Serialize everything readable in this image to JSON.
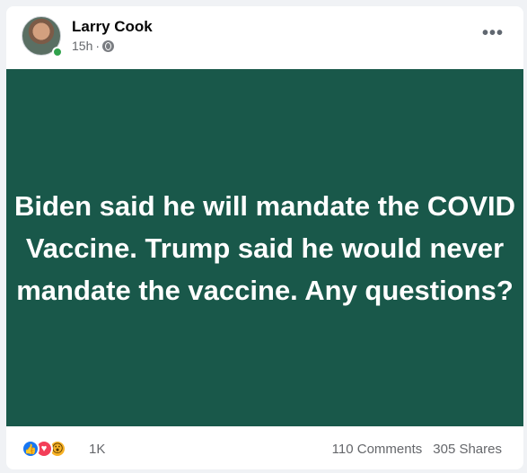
{
  "post": {
    "author": "Larry Cook",
    "time": "15h",
    "separator": "·",
    "audience_icon": "globe-icon",
    "more_label": "•••",
    "banner_text": "Biden said he will mandate the COVID Vaccine. Trump said he would never mandate the vaccine. Any questions?",
    "banner_color": "#19584a",
    "reactions": {
      "icons": [
        "like-icon",
        "love-icon",
        "wow-icon"
      ],
      "like_glyph": "👍",
      "love_glyph": "♥",
      "wow_glyph": "😮",
      "count": "1K"
    },
    "comments": "110 Comments",
    "shares": "305 Shares"
  }
}
